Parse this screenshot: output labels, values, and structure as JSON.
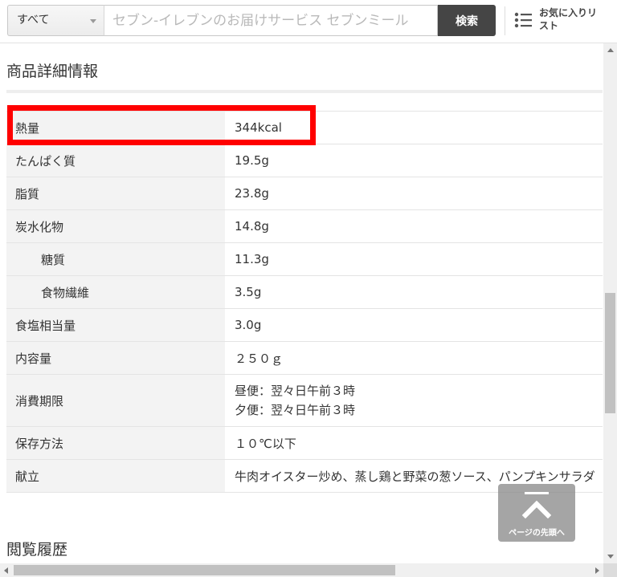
{
  "search": {
    "category_label": "すべて",
    "placeholder": "セブン-イレブンのお届けサービス セブンミール",
    "button_label": "検索"
  },
  "favorites": {
    "label": "お気に入りリスト",
    "icon": "list-icon"
  },
  "product_details": {
    "title": "商品詳細情報",
    "rows": [
      {
        "key": "熱量",
        "value": "344kcal",
        "highlighted": true
      },
      {
        "key": "たんぱく質",
        "value": "19.5g"
      },
      {
        "key": "脂質",
        "value": "23.8g"
      },
      {
        "key": "炭水化物",
        "value": "14.8g"
      },
      {
        "key": "糖質",
        "value": "11.3g",
        "indent": true
      },
      {
        "key": "食物繊維",
        "value": "3.5g",
        "indent": true
      },
      {
        "key": "食塩相当量",
        "value": "3.0g"
      },
      {
        "key": "内容量",
        "value": "２５０ｇ"
      },
      {
        "key": "消費期限",
        "value_lines": [
          "昼便：翌々日午前３時",
          "夕便：翌々日午前３時"
        ]
      },
      {
        "key": "保存方法",
        "value": "１０℃以下"
      },
      {
        "key": "献立",
        "value": "牛肉オイスター炒め、蒸し鶏と野菜の葱ソース、パンプキンサラダ"
      }
    ]
  },
  "history": {
    "title": "閲覧履歴"
  },
  "back_to_top": {
    "label": "ページの先頭へ",
    "icon": "chevron-up-icon"
  },
  "colors": {
    "highlight": "#ff0000",
    "search_button": "#454545",
    "key_cell_bg": "#f3f3f3"
  }
}
